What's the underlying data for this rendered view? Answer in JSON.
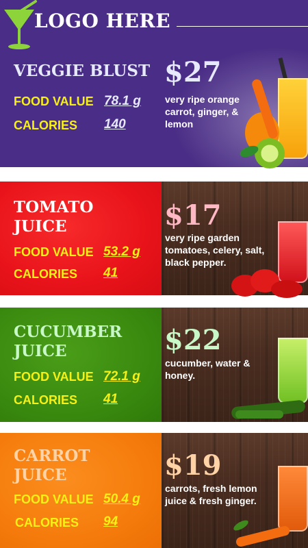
{
  "header": {
    "logo_text": "LOGO HERE",
    "bg": "#4a2d86"
  },
  "items": [
    {
      "name": "VEGGIE BLUST",
      "price": "$27",
      "food_value_label": "FOOD VALUE",
      "food_value": "78.1 g",
      "calories_label": "CALORIES",
      "calories": "140",
      "description": "very ripe orange carrot, ginger, & lemon",
      "bg": "#4a2d86",
      "accent": "#e7e9ff",
      "label_color": "#f6f016"
    },
    {
      "name_line1": "TOMATO",
      "name_line2": "JUICE",
      "price": "$17",
      "food_value_label": "FOOD VALUE",
      "food_value": "53.2 g",
      "calories_label": "CALORIES",
      "calories": "41",
      "description": "very ripe garden tomatoes, celery, salt, black pepper.",
      "bg": "#e8131a",
      "accent": "#ffb8c4",
      "label_color": "#f6f016"
    },
    {
      "name_line1": "CUCUMBER",
      "name_line2": "JUICE",
      "price": "$22",
      "food_value_label": "FOOD VALUE",
      "food_value": "72.1 g",
      "calories_label": "CALORIES",
      "calories": "41",
      "description": "cucumber, water & honey.",
      "bg": "#3a8a0f",
      "accent": "#c8f7c8",
      "label_color": "#f6f016"
    },
    {
      "name_line1": "CARROT",
      "name_line2": "JUICE",
      "price": "$19",
      "food_value_label": "FOOD VALUE",
      "food_value": "50.4 g",
      "calories_label": "CALORIES",
      "calories": "94",
      "description": "carrots, fresh lemon juice & fresh ginger.",
      "bg": "#f57c0c",
      "accent": "#ffd3a6",
      "label_color": "#f6f016"
    }
  ],
  "icons": [
    "cocktail-glass-icon"
  ]
}
